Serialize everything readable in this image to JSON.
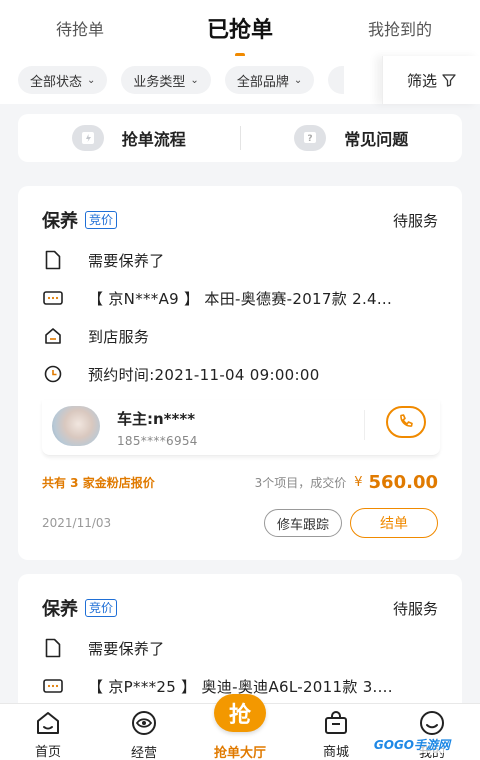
{
  "tabs": [
    {
      "label": "待抢单"
    },
    {
      "label": "已抢单"
    },
    {
      "label": "我抢到的"
    }
  ],
  "filters": {
    "status": "全部状态",
    "business_type": "业务类型",
    "brand": "全部品牌",
    "filter_label": "筛选"
  },
  "quick_links": {
    "process": "抢单流程",
    "faq": "常见问题"
  },
  "orders": [
    {
      "service_type": "保养",
      "tag": "竞价",
      "status": "待服务",
      "note": "需要保养了",
      "vehicle": "【 京N***A9 】 本田-奥德赛-2017款 2.4...",
      "service_mode": "到店服务",
      "appointment": "预约时间:2021-11-04 09:00:00",
      "owner_name": "车主:n****",
      "owner_phone": "185****6954",
      "stores_quote": "共有 3 家金粉店报价",
      "price_desc": "3个项目，成交价",
      "currency": "¥",
      "price": "560.00",
      "date": "2021/11/03",
      "track_label": "修车跟踪",
      "finish_label": "结单"
    },
    {
      "service_type": "保养",
      "tag": "竞价",
      "status": "待服务",
      "note": "需要保养了",
      "vehicle": "【 京P***25 】 奥迪-奥迪A6L-2011款 3...."
    }
  ],
  "bottom_nav": [
    {
      "label": "首页",
      "icon": "home-icon"
    },
    {
      "label": "经营",
      "icon": "eye-icon"
    },
    {
      "label": "抢单大厅",
      "icon": "grab-icon",
      "badge": "抢"
    },
    {
      "label": "商城",
      "icon": "shop-bag-icon"
    },
    {
      "label": "我的",
      "icon": "smile-icon"
    }
  ],
  "watermark": "GOGO手游网",
  "colors": {
    "accent": "#f08a00",
    "tag_blue": "#1f6fd6"
  }
}
